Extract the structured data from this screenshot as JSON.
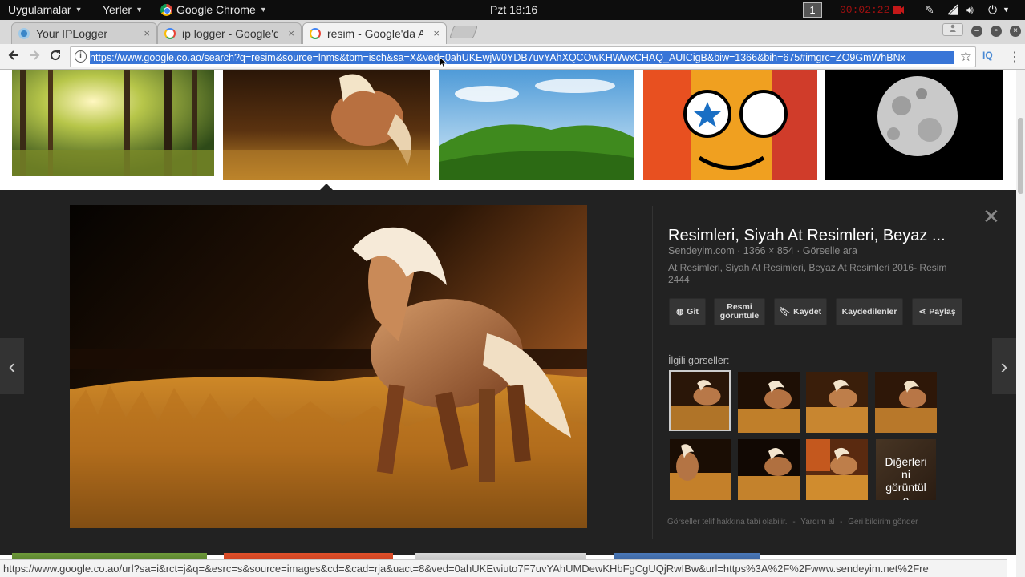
{
  "topbar": {
    "apps_label": "Uygulamalar",
    "places_label": "Yerler",
    "active_app": "Google Chrome",
    "clock": "Pzt 18:16",
    "workspace": "1",
    "recording_time": "00:02:22"
  },
  "tabs": [
    {
      "label": "Your IPLogger",
      "close": "×"
    },
    {
      "label": "ip logger - Google'd",
      "close": "×"
    },
    {
      "label": "resim - Google'da A",
      "close": "×"
    }
  ],
  "toolbar": {
    "info": "i",
    "url": "https://www.google.co.ao/search?q=resim&source=lnms&tbm=isch&sa=X&ved=0ahUKEwjW0YDB7uvYAhXQCOwKHWwxCHAQ_AUICigB&biw=1366&bih=675#imgrc=ZO9GmWhBNx",
    "extension": "IQ"
  },
  "panel": {
    "title": "Resimleri, Siyah At Resimleri, Beyaz ...",
    "meta": [
      "Sendeyim.com",
      "1366 × 854",
      "Görselle ara"
    ],
    "description": "At Resimleri, Siyah At Resimleri, Beyaz At Resimleri 2016- Resim 2444",
    "actions": {
      "visit": "Git",
      "view_line1": "Resmi",
      "view_line2": "görüntüle",
      "save": "Kaydet",
      "saved": "Kaydedilenler",
      "share": "Paylaş"
    },
    "related_label": "İlgili görseller:",
    "more_line1": "Diğerleri",
    "more_line2": "ni",
    "more_line3": "görüntül",
    "more_line4": "e",
    "footer": [
      "Görseller telif hakkına tabi olabilir.",
      "-",
      "Yardım al",
      "-",
      "Geri bildirim gönder"
    ]
  },
  "status_url": "https://www.google.co.ao/url?sa=i&rct=j&q=&esrc=s&source=images&cd=&cad=rja&uact=8&ved=0ahUKEwiuto7F7uvYAhUMDewKHbFgCgUQjRwIBw&url=https%3A%2F%2Fwww.sendeyim.net%2Fre"
}
